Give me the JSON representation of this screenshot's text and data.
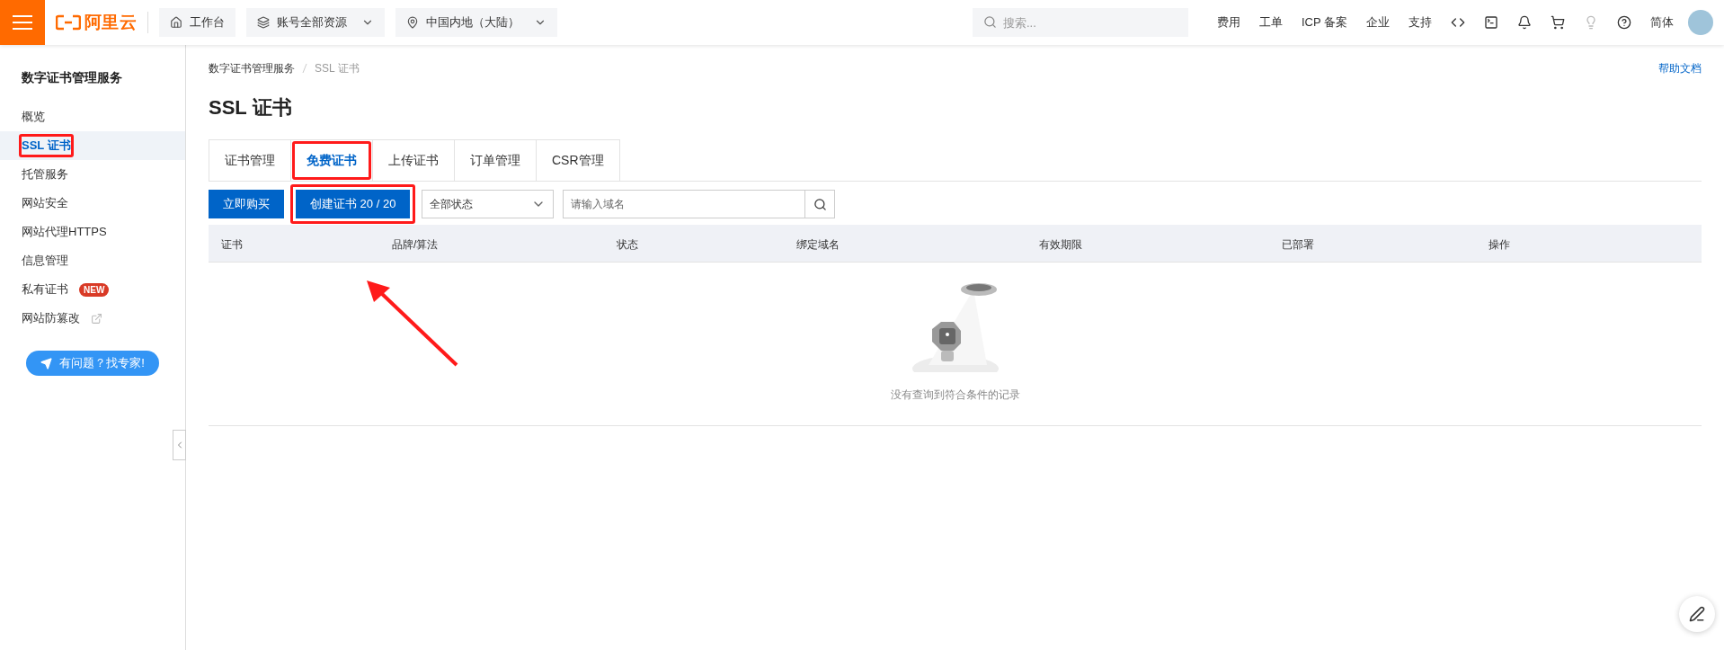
{
  "topbar": {
    "logo": "阿里云",
    "nav_buttons": [
      {
        "kind": "home",
        "label": "工作台",
        "dropdown": false
      },
      {
        "kind": "resources",
        "label": "账号全部资源",
        "dropdown": true
      },
      {
        "kind": "region",
        "label": "中国内地（大陆）",
        "dropdown": true
      }
    ],
    "search": {
      "placeholder": "搜索..."
    },
    "links": [
      "费用",
      "工单",
      "ICP 备案",
      "企业",
      "支持"
    ],
    "language": "简体"
  },
  "sidebar": {
    "title": "数字证书管理服务",
    "items": [
      {
        "label": "概览",
        "selected": false,
        "highlighted": false
      },
      {
        "label": "SSL 证书",
        "selected": true,
        "highlighted": true
      },
      {
        "label": "托管服务",
        "selected": false,
        "highlighted": false
      },
      {
        "label": "网站安全",
        "selected": false,
        "highlighted": false
      },
      {
        "label": "网站代理HTTPS",
        "selected": false,
        "highlighted": false
      },
      {
        "label": "信息管理",
        "selected": false,
        "highlighted": false
      },
      {
        "label": "私有证书",
        "selected": false,
        "highlighted": false,
        "badge": "NEW"
      },
      {
        "label": "网站防篡改",
        "selected": false,
        "highlighted": false,
        "external": true
      }
    ],
    "help_button": "有问题？找专家!"
  },
  "breadcrumb": [
    "数字证书管理服务",
    "SSL 证书"
  ],
  "help_link": "帮助文档",
  "page_title": "SSL 证书",
  "tabs": [
    {
      "label": "证书管理",
      "selected": false,
      "highlighted": false
    },
    {
      "label": "免费证书",
      "selected": true,
      "highlighted": true
    },
    {
      "label": "上传证书",
      "selected": false,
      "highlighted": false
    },
    {
      "label": "订单管理",
      "selected": false,
      "highlighted": false
    },
    {
      "label": "CSR管理",
      "selected": false,
      "highlighted": false
    }
  ],
  "toolbar": {
    "buy_button": "立即购买",
    "create_button": {
      "label": "创建证书 20 / 20",
      "highlighted": true
    },
    "status_select": "全部状态",
    "domain_search": {
      "placeholder": "请输入域名"
    }
  },
  "table": {
    "columns": [
      "证书",
      "品牌/算法",
      "状态",
      "绑定域名",
      "有效期限",
      "已部署",
      "操作"
    ],
    "empty_text": "没有查询到符合条件的记录"
  }
}
